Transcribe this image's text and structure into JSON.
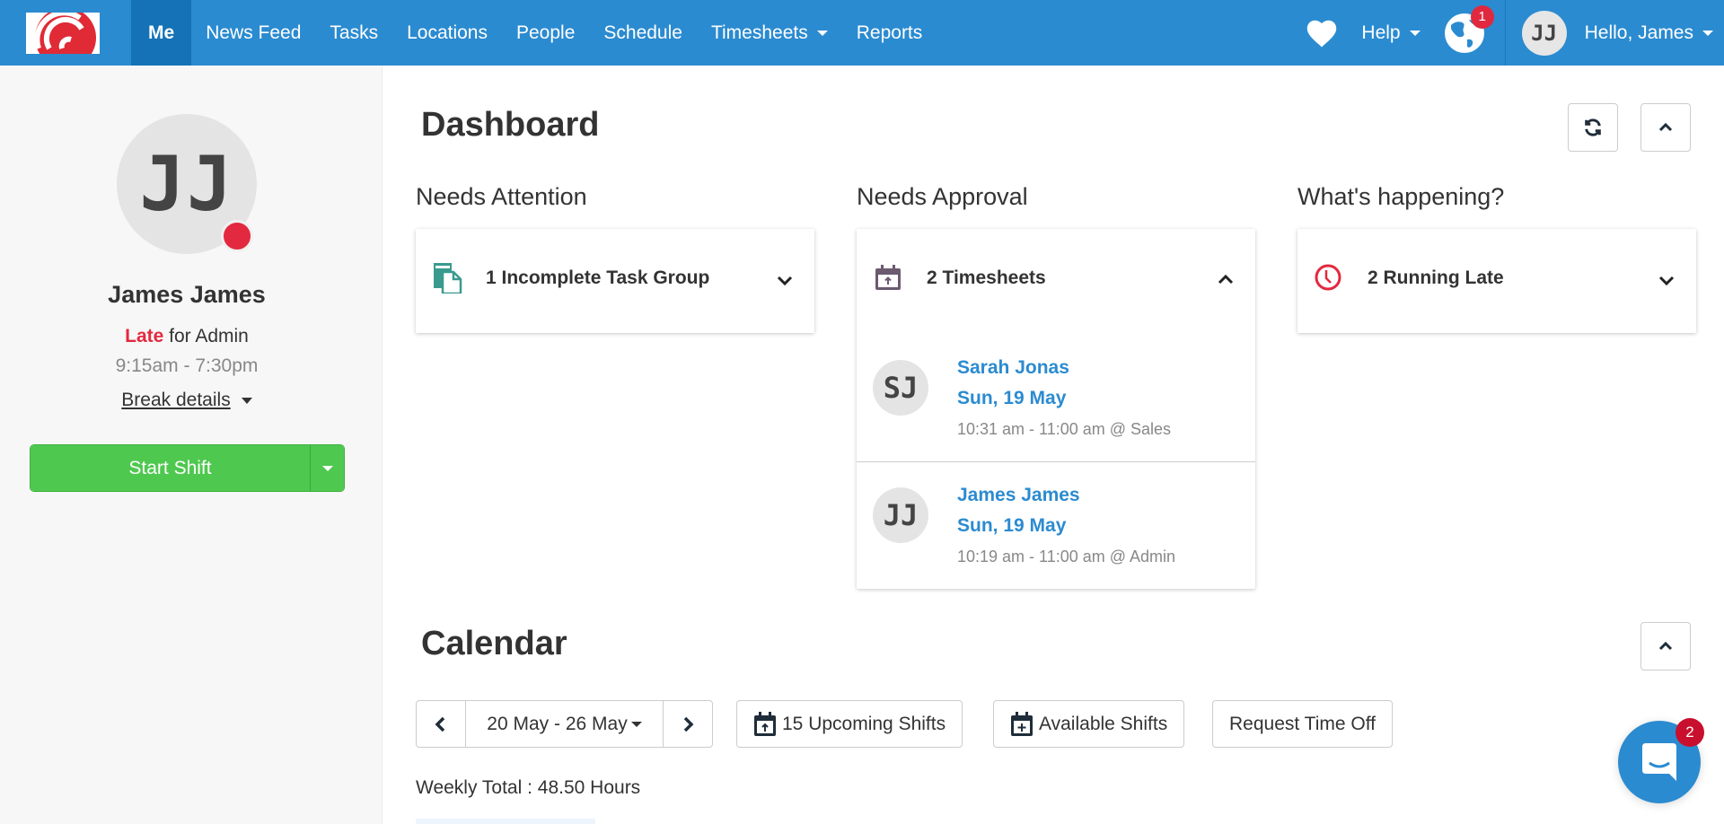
{
  "navbar": {
    "brand_color": "#2b8bd0",
    "active_color": "#1572b6",
    "items": [
      {
        "label": "Me",
        "active": true
      },
      {
        "label": "News Feed"
      },
      {
        "label": "Tasks"
      },
      {
        "label": "Locations"
      },
      {
        "label": "People"
      },
      {
        "label": "Schedule"
      },
      {
        "label": "Timesheets",
        "dropdown": true
      },
      {
        "label": "Reports"
      }
    ],
    "help_label": "Help",
    "notifications_count": "1",
    "user_initials": "JJ",
    "greeting": "Hello, James"
  },
  "sidebar": {
    "initials": "JJ",
    "status_color": "#e3293f",
    "name": "James James",
    "status_word": "Late",
    "status_rest": " for Admin",
    "shift_time": "9:15am - 7:30pm",
    "break_details_label": "Break details",
    "start_shift_label": "Start Shift"
  },
  "dashboard": {
    "title": "Dashboard",
    "refresh_icon": "refresh-icon",
    "collapse_icon": "chevron-up-icon",
    "columns": [
      {
        "title": "Needs Attention",
        "card_label": "1 Incomplete Task Group",
        "icon": "task-group-icon",
        "icon_color": "#3a9a8e",
        "expanded": false
      },
      {
        "title": "Needs Approval",
        "card_label": "2 Timesheets",
        "icon": "calendar-upload-icon",
        "icon_color": "#6b5a70",
        "expanded": true,
        "items": [
          {
            "initials": "SJ",
            "name": "Sarah Jonas",
            "date": "Sun, 19 May",
            "time": "10:31 am - 11:00 am @ Sales"
          },
          {
            "initials": "JJ",
            "name": "James James",
            "date": "Sun, 19 May",
            "time": "10:19 am - 11:00 am @ Admin"
          }
        ]
      },
      {
        "title": "What's happening?",
        "card_label": "2 Running Late",
        "icon": "clock-icon",
        "icon_color": "#e3293f",
        "expanded": false
      }
    ]
  },
  "calendar": {
    "title": "Calendar",
    "range_label": "20 May - 26 May",
    "upcoming_label": "15 Upcoming Shifts",
    "available_label": "Available Shifts",
    "time_off_label": "Request Time Off",
    "weekly_total": "Weekly Total : 48.50 Hours"
  },
  "chat": {
    "unread_count": "2"
  }
}
